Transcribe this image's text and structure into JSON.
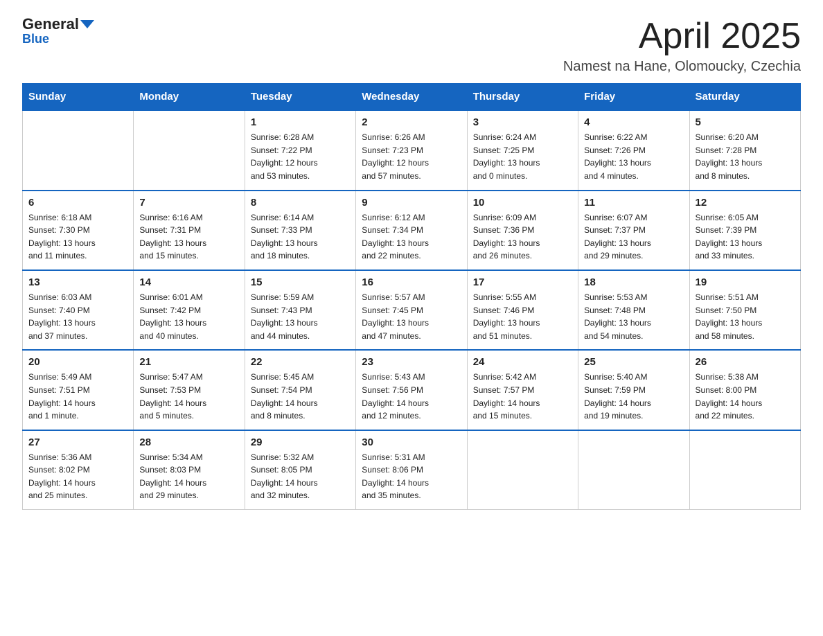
{
  "logo": {
    "general": "General",
    "blue": "Blue",
    "triangle_color": "#1565c0"
  },
  "header": {
    "month": "April 2025",
    "location": "Namest na Hane, Olomoucky, Czechia"
  },
  "days_of_week": [
    "Sunday",
    "Monday",
    "Tuesday",
    "Wednesday",
    "Thursday",
    "Friday",
    "Saturday"
  ],
  "weeks": [
    [
      {
        "day": "",
        "info": ""
      },
      {
        "day": "",
        "info": ""
      },
      {
        "day": "1",
        "info": "Sunrise: 6:28 AM\nSunset: 7:22 PM\nDaylight: 12 hours\nand 53 minutes."
      },
      {
        "day": "2",
        "info": "Sunrise: 6:26 AM\nSunset: 7:23 PM\nDaylight: 12 hours\nand 57 minutes."
      },
      {
        "day": "3",
        "info": "Sunrise: 6:24 AM\nSunset: 7:25 PM\nDaylight: 13 hours\nand 0 minutes."
      },
      {
        "day": "4",
        "info": "Sunrise: 6:22 AM\nSunset: 7:26 PM\nDaylight: 13 hours\nand 4 minutes."
      },
      {
        "day": "5",
        "info": "Sunrise: 6:20 AM\nSunset: 7:28 PM\nDaylight: 13 hours\nand 8 minutes."
      }
    ],
    [
      {
        "day": "6",
        "info": "Sunrise: 6:18 AM\nSunset: 7:30 PM\nDaylight: 13 hours\nand 11 minutes."
      },
      {
        "day": "7",
        "info": "Sunrise: 6:16 AM\nSunset: 7:31 PM\nDaylight: 13 hours\nand 15 minutes."
      },
      {
        "day": "8",
        "info": "Sunrise: 6:14 AM\nSunset: 7:33 PM\nDaylight: 13 hours\nand 18 minutes."
      },
      {
        "day": "9",
        "info": "Sunrise: 6:12 AM\nSunset: 7:34 PM\nDaylight: 13 hours\nand 22 minutes."
      },
      {
        "day": "10",
        "info": "Sunrise: 6:09 AM\nSunset: 7:36 PM\nDaylight: 13 hours\nand 26 minutes."
      },
      {
        "day": "11",
        "info": "Sunrise: 6:07 AM\nSunset: 7:37 PM\nDaylight: 13 hours\nand 29 minutes."
      },
      {
        "day": "12",
        "info": "Sunrise: 6:05 AM\nSunset: 7:39 PM\nDaylight: 13 hours\nand 33 minutes."
      }
    ],
    [
      {
        "day": "13",
        "info": "Sunrise: 6:03 AM\nSunset: 7:40 PM\nDaylight: 13 hours\nand 37 minutes."
      },
      {
        "day": "14",
        "info": "Sunrise: 6:01 AM\nSunset: 7:42 PM\nDaylight: 13 hours\nand 40 minutes."
      },
      {
        "day": "15",
        "info": "Sunrise: 5:59 AM\nSunset: 7:43 PM\nDaylight: 13 hours\nand 44 minutes."
      },
      {
        "day": "16",
        "info": "Sunrise: 5:57 AM\nSunset: 7:45 PM\nDaylight: 13 hours\nand 47 minutes."
      },
      {
        "day": "17",
        "info": "Sunrise: 5:55 AM\nSunset: 7:46 PM\nDaylight: 13 hours\nand 51 minutes."
      },
      {
        "day": "18",
        "info": "Sunrise: 5:53 AM\nSunset: 7:48 PM\nDaylight: 13 hours\nand 54 minutes."
      },
      {
        "day": "19",
        "info": "Sunrise: 5:51 AM\nSunset: 7:50 PM\nDaylight: 13 hours\nand 58 minutes."
      }
    ],
    [
      {
        "day": "20",
        "info": "Sunrise: 5:49 AM\nSunset: 7:51 PM\nDaylight: 14 hours\nand 1 minute."
      },
      {
        "day": "21",
        "info": "Sunrise: 5:47 AM\nSunset: 7:53 PM\nDaylight: 14 hours\nand 5 minutes."
      },
      {
        "day": "22",
        "info": "Sunrise: 5:45 AM\nSunset: 7:54 PM\nDaylight: 14 hours\nand 8 minutes."
      },
      {
        "day": "23",
        "info": "Sunrise: 5:43 AM\nSunset: 7:56 PM\nDaylight: 14 hours\nand 12 minutes."
      },
      {
        "day": "24",
        "info": "Sunrise: 5:42 AM\nSunset: 7:57 PM\nDaylight: 14 hours\nand 15 minutes."
      },
      {
        "day": "25",
        "info": "Sunrise: 5:40 AM\nSunset: 7:59 PM\nDaylight: 14 hours\nand 19 minutes."
      },
      {
        "day": "26",
        "info": "Sunrise: 5:38 AM\nSunset: 8:00 PM\nDaylight: 14 hours\nand 22 minutes."
      }
    ],
    [
      {
        "day": "27",
        "info": "Sunrise: 5:36 AM\nSunset: 8:02 PM\nDaylight: 14 hours\nand 25 minutes."
      },
      {
        "day": "28",
        "info": "Sunrise: 5:34 AM\nSunset: 8:03 PM\nDaylight: 14 hours\nand 29 minutes."
      },
      {
        "day": "29",
        "info": "Sunrise: 5:32 AM\nSunset: 8:05 PM\nDaylight: 14 hours\nand 32 minutes."
      },
      {
        "day": "30",
        "info": "Sunrise: 5:31 AM\nSunset: 8:06 PM\nDaylight: 14 hours\nand 35 minutes."
      },
      {
        "day": "",
        "info": ""
      },
      {
        "day": "",
        "info": ""
      },
      {
        "day": "",
        "info": ""
      }
    ]
  ]
}
